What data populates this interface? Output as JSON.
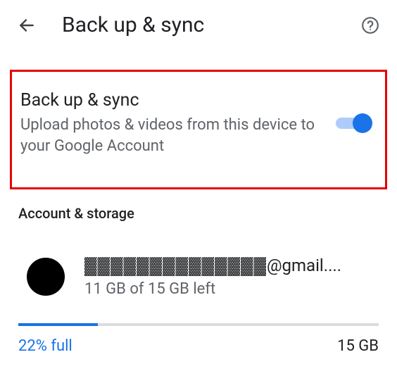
{
  "header": {
    "title": "Back up & sync"
  },
  "backup": {
    "title": "Back up & sync",
    "description": "Upload photos & videos from this device to your Google Account",
    "enabled": true
  },
  "section_label": "Account & storage",
  "account": {
    "email_masked_prefix": "▓▓▓▓▓▓▓▓▓▓▓▓▓▓",
    "email_suffix": "@gmail....",
    "storage_text": "11 GB of 15 GB left"
  },
  "storage": {
    "percent_label": "22% full",
    "percent_value": 22,
    "total_label": "15 GB"
  }
}
